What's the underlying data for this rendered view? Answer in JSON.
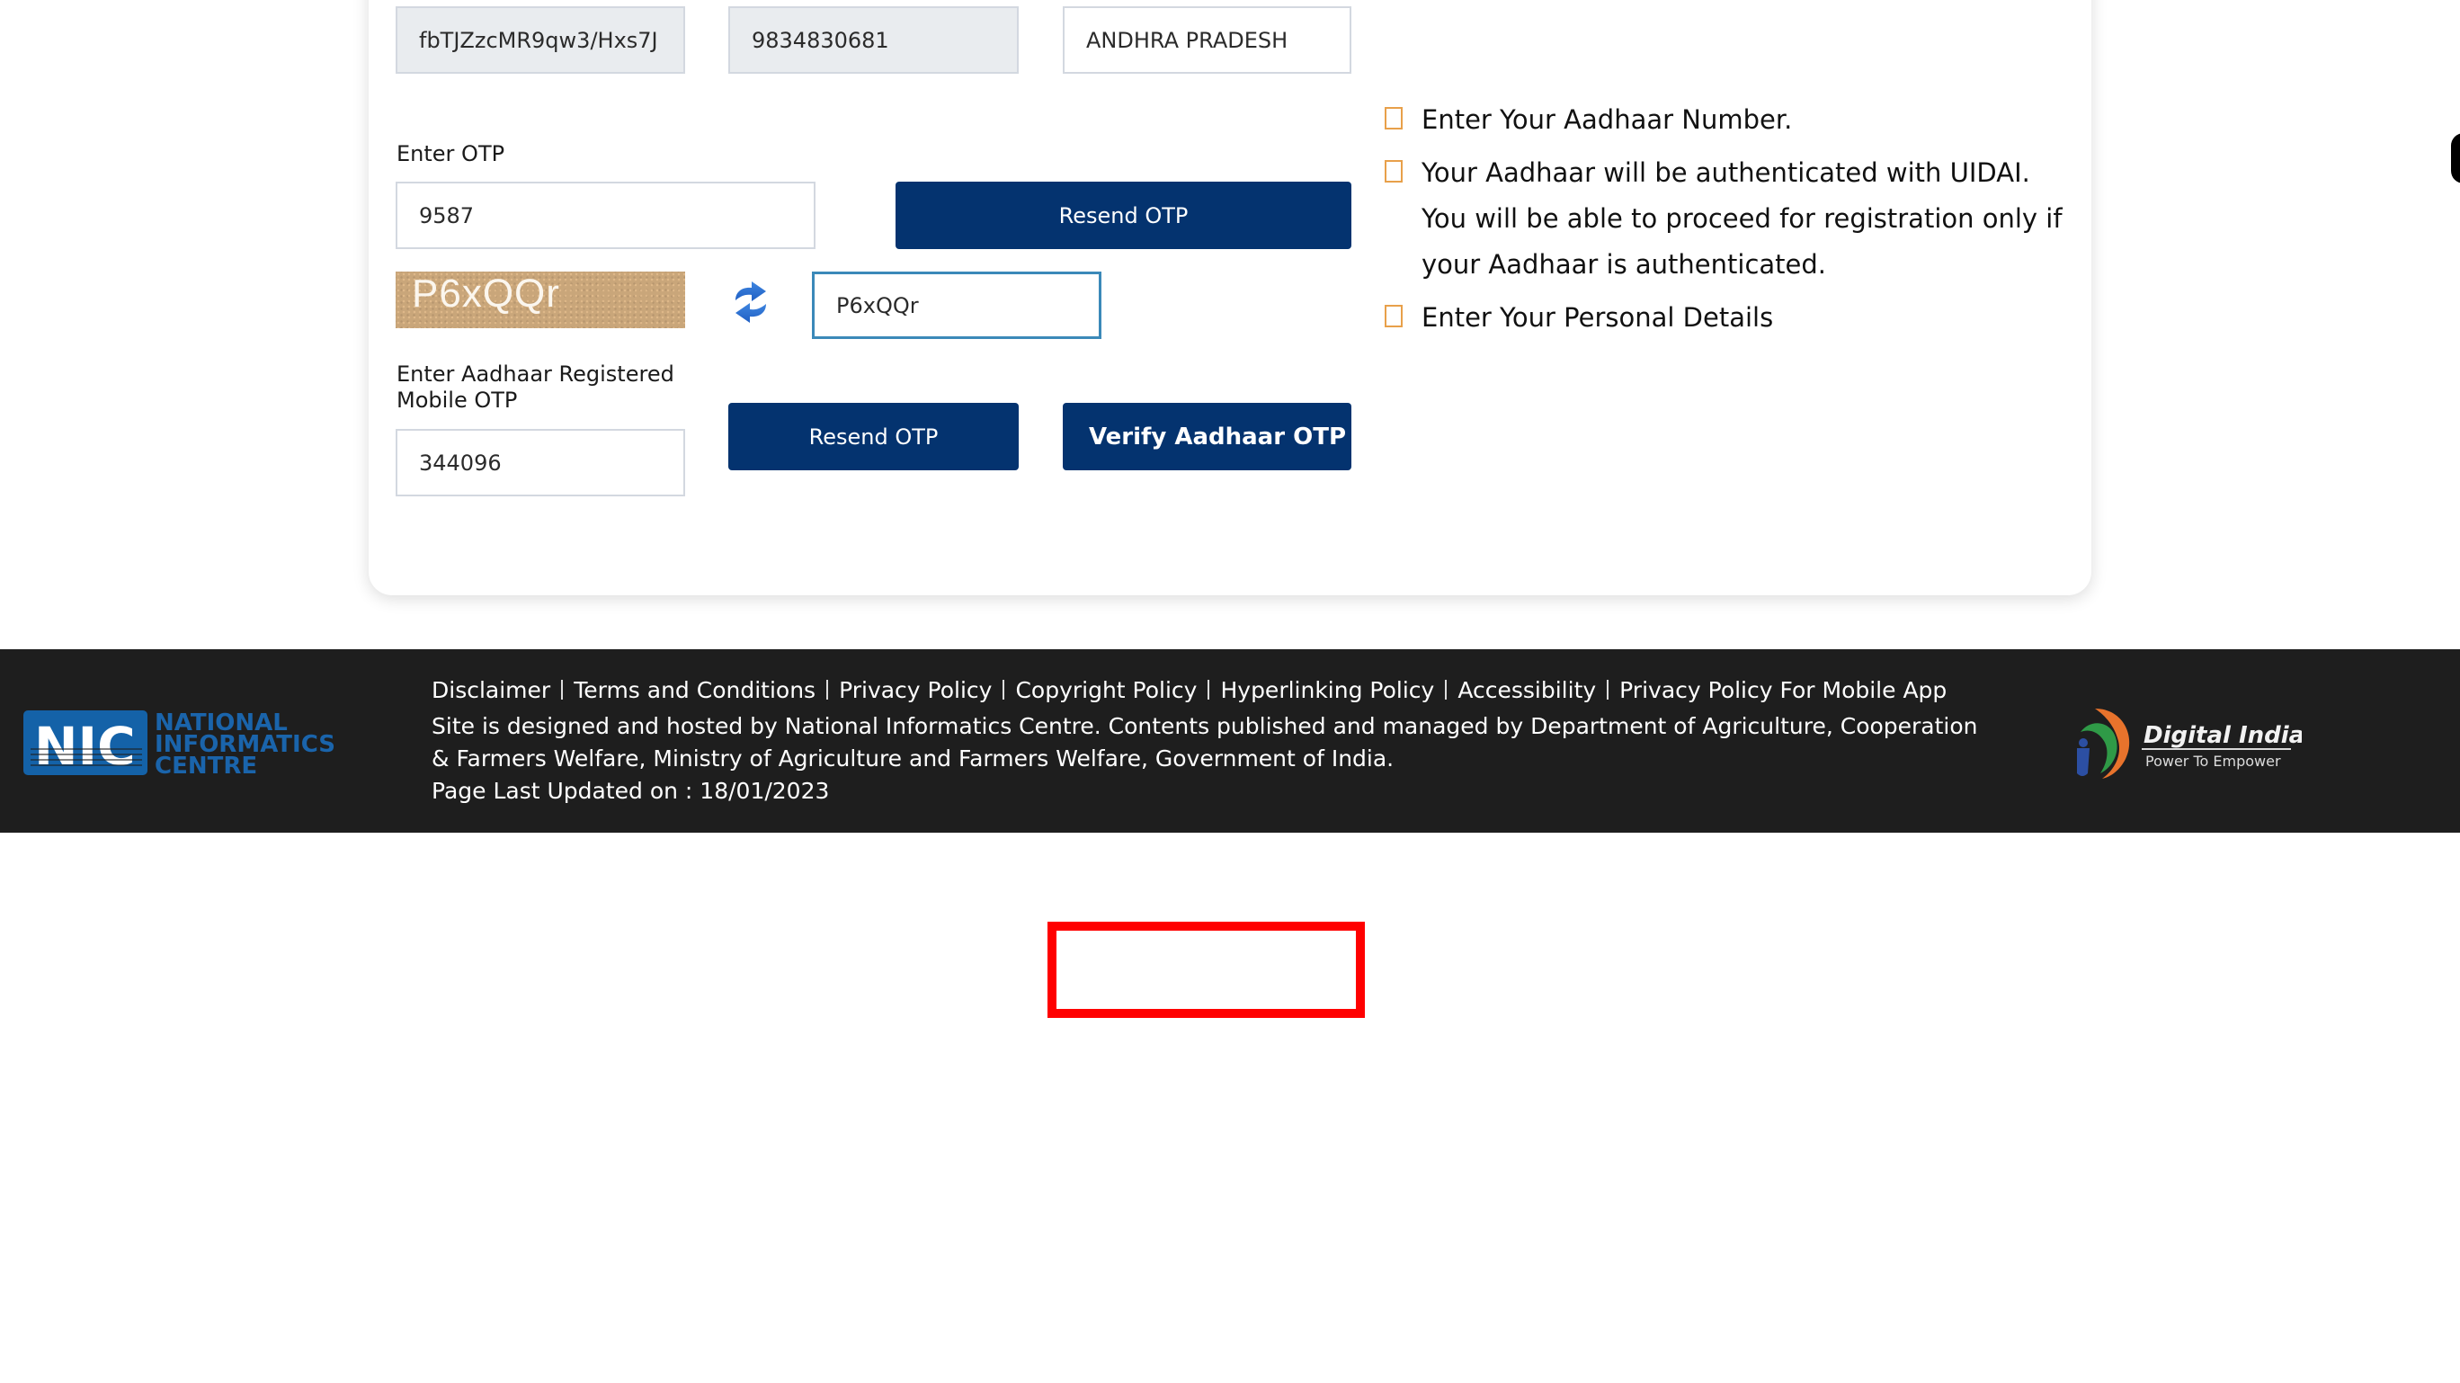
{
  "form": {
    "aadhaar_encrypted_value": "fbTJZzcMR9qw3/Hxs7J",
    "mobile_value": "9834830681",
    "state_value": "ANDHRA PRADESH",
    "otp_label": "Enter OTP",
    "otp_value": "9587",
    "resend_otp_label": "Resend OTP",
    "captcha_text": "P6xQQr",
    "captcha_input_value": "P6xQQr",
    "mobile_otp_label_line1": "Enter Aadhaar Registered",
    "mobile_otp_label_line2": "Mobile OTP",
    "mobile_otp_value": "344096",
    "resend_otp_label_2": "Resend OTP",
    "verify_label": "Verify Aadhaar OTP"
  },
  "steps": [
    {
      "text": "Enter Your Aadhaar Number."
    },
    {
      "text": "Your Aadhaar will be authenticated with UIDAI. You will be able to proceed for registration only if your Aadhaar is authenticated."
    },
    {
      "text": "Enter Your Personal Details"
    }
  ],
  "footer": {
    "links": [
      "Disclaimer",
      "Terms and Conditions",
      "Privacy Policy",
      "Copyright Policy",
      "Hyperlinking Policy",
      "Accessibility",
      "Privacy Policy For Mobile App"
    ],
    "hosted_text": "Site is designed and hosted by National Informatics Centre. Contents published and managed by Department of Agriculture, Cooperation & Farmers Welfare, Ministry of Agriculture and Farmers Welfare, Government of India.",
    "updated_text": "Page Last Updated on : 18/01/2023",
    "nic_logo": {
      "abbr": "NIC",
      "line1": "NATIONAL",
      "line2": "INFORMATICS",
      "line3": "CENTRE"
    },
    "digital_india_logo": {
      "title": "Digital India",
      "tagline": "Power To Empower"
    }
  },
  "colors": {
    "primary_button": "#04336f",
    "footer_bg": "#1e1e1e",
    "checkbox_border": "#e8a04a",
    "focus_border": "#3b89b9",
    "highlight_box": "#ff0000"
  }
}
